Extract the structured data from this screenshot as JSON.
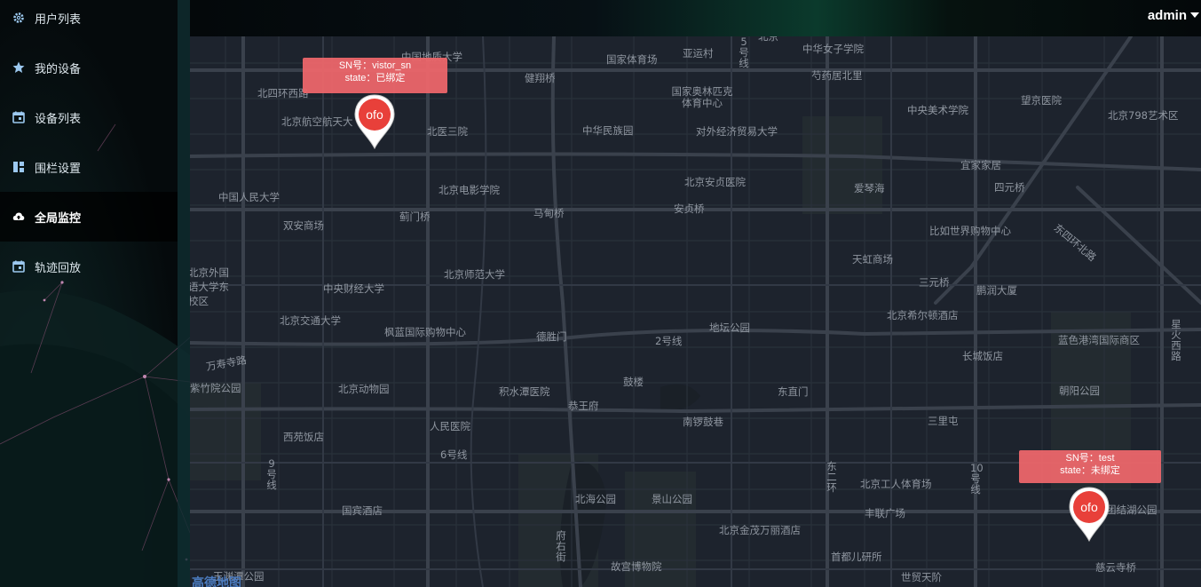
{
  "header": {
    "user": "admin"
  },
  "sidebar": {
    "items": [
      {
        "label": "用户列表",
        "icon": "gear-icon"
      },
      {
        "label": "我的设备",
        "icon": "star-icon"
      },
      {
        "label": "设备列表",
        "icon": "calendar-icon"
      },
      {
        "label": "围栏设置",
        "icon": "grid-icon"
      },
      {
        "label": "全局监控",
        "icon": "cloud-upload-icon",
        "active": true
      },
      {
        "label": "轨迹回放",
        "icon": "calendar-icon"
      }
    ]
  },
  "map": {
    "labels": [
      "中国地质大学",
      "北四环西路",
      "北京航空航天大",
      "北医三院",
      "健翔桥",
      "国家体育场",
      "亚运村",
      "5号线",
      "中华女子学院",
      "芍药居北里",
      "国家奥林匹克体育中心",
      "望京医院",
      "中央美术学院",
      "北京798艺术区",
      "中华民族园",
      "对外经济贸易大学",
      "宜家家居",
      "中国人民大学",
      "北京电影学院",
      "北京安贞医院",
      "爱琴海",
      "四元桥",
      "蓟门桥",
      "马甸桥",
      "安贞桥",
      "双安商场",
      "比如世界购物中心",
      "东四环北路",
      "天虹商场",
      "北京外国语大学东校区",
      "中央财经大学",
      "北京师范大学",
      "三元桥",
      "鹏润大厦",
      "北京交通大学",
      "北京希尔顿酒店",
      "星火西路",
      "枫蓝国际购物中心",
      "德胜门",
      "2号线",
      "地坛公园",
      "万寿寺路",
      "蓝色港湾国际商区",
      "长城饭店",
      "北京动物园",
      "积水潭医院",
      "鼓楼",
      "东直门",
      "朝阳公园",
      "恭王府",
      "南锣鼓巷",
      "三里屯",
      "西苑饭店",
      "人民医院",
      "6号线",
      "9号线",
      "10号线",
      "北京工人体育场",
      "北海公园",
      "景山公园",
      "东二环",
      "国宾酒店",
      "丰联广场",
      "北京金茂万丽酒店",
      "府右街",
      "首都儿研所",
      "故宫博物院",
      "世贸天阶",
      "慈云寺桥",
      "团结湖公园",
      "玉渊潭公园",
      "紫竹院公园",
      "北京",
      "高德地图"
    ]
  },
  "markers": [
    {
      "sn_label": "SN号：vistor_sn",
      "state_label": "state：已绑定",
      "logo": "ofo"
    },
    {
      "sn_label": "SN号：test",
      "state_label": "state：未绑定",
      "logo": "ofo"
    }
  ],
  "colors": {
    "marker": "#e8403a",
    "tooltip": "#ec666a",
    "map_bg": "#1d232d",
    "road": "#2d3440",
    "major_road": "#3a414c"
  }
}
